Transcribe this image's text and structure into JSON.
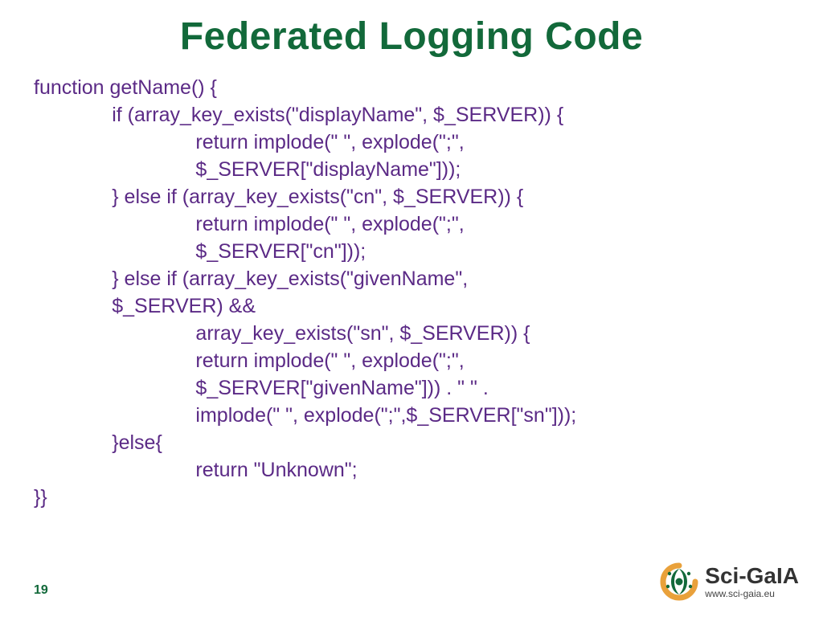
{
  "title": "Federated Logging Code",
  "page_number": "19",
  "code_lines": [
    "function getName() {",
    "              if (array_key_exists(\"displayName\", $_SERVER)) {",
    "                             return implode(\" \", explode(\";\",",
    "                             $_SERVER[\"displayName\"]));",
    "              } else if (array_key_exists(\"cn\", $_SERVER)) {",
    "                             return implode(\" \", explode(\";\",",
    "                             $_SERVER[\"cn\"]));",
    "              } else if (array_key_exists(\"givenName\",",
    "              $_SERVER) &&",
    "                             array_key_exists(\"sn\", $_SERVER)) {",
    "                             return implode(\" \", explode(\";\",",
    "                             $_SERVER[\"givenName\"])) . \" \" .",
    "                             implode(\" \", explode(\";\",$_SERVER[\"sn\"]));",
    "              }else{",
    "                             return \"Unknown\";",
    "}}"
  ],
  "logo": {
    "brand_part1": "Sci",
    "brand_dash": "-",
    "brand_part2": "GaIA",
    "url": "www.sci-gaia.eu"
  }
}
